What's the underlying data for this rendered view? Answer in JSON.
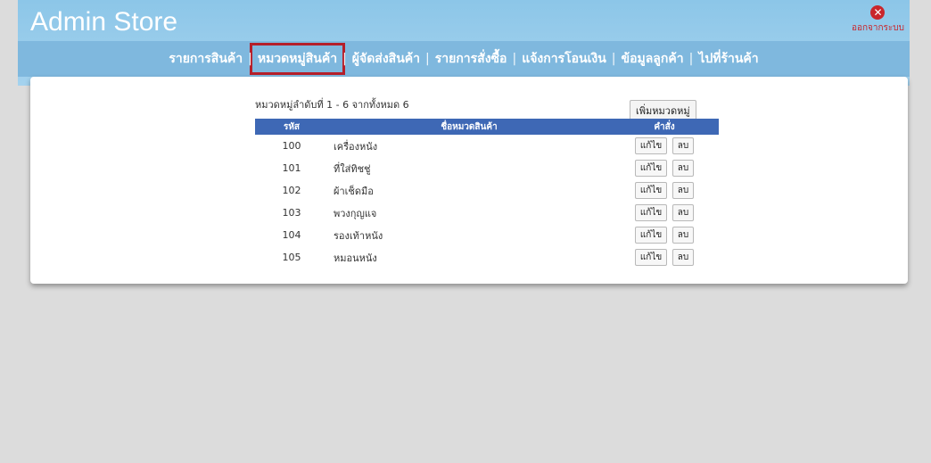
{
  "app": {
    "title": "Admin Store",
    "logout_label": "ออกจากระบบ",
    "logout_icon": "close-circle-icon"
  },
  "nav": {
    "items": [
      {
        "label": "รายการสินค้า"
      },
      {
        "label": "หมวดหมู่สินค้า",
        "active": true
      },
      {
        "label": "ผู้จัดส่งสินค้า"
      },
      {
        "label": "รายการสั่งซื้อ"
      },
      {
        "label": "แจ้งการโอนเงิน"
      },
      {
        "label": "ข้อมูลลูกค้า"
      },
      {
        "label": "ไปที่ร้านค้า"
      }
    ]
  },
  "categories": {
    "summary": "หมวดหมู่ลำดับที่ 1 - 6 จากทั้งหมด 6",
    "add_button": "เพิ่มหมวดหมู่",
    "columns": {
      "code": "รหัส",
      "name": "ชื่อหมวดสินค้า",
      "actions": "คำสั่ง"
    },
    "rows": [
      {
        "code": "100",
        "name": "เครื่องหนัง",
        "edit": "แก้ไข",
        "delete": "ลบ"
      },
      {
        "code": "101",
        "name": "ที่ใส่ทิชชู่",
        "edit": "แก้ไข",
        "delete": "ลบ"
      },
      {
        "code": "102",
        "name": "ผ้าเช็ดมือ",
        "edit": "แก้ไข",
        "delete": "ลบ"
      },
      {
        "code": "103",
        "name": "พวงกุญแจ",
        "edit": "แก้ไข",
        "delete": "ลบ"
      },
      {
        "code": "104",
        "name": "รองเท้าหนัง",
        "edit": "แก้ไข",
        "delete": "ลบ"
      },
      {
        "code": "105",
        "name": "หมอนหนัง",
        "edit": "แก้ไข",
        "delete": "ลบ"
      }
    ]
  },
  "colors": {
    "header_bg": "#8cc6e8",
    "nav_bg": "#7fb8de",
    "table_header": "#3e68b5",
    "active_outline": "#b51f2a",
    "logout": "#c9262c"
  }
}
